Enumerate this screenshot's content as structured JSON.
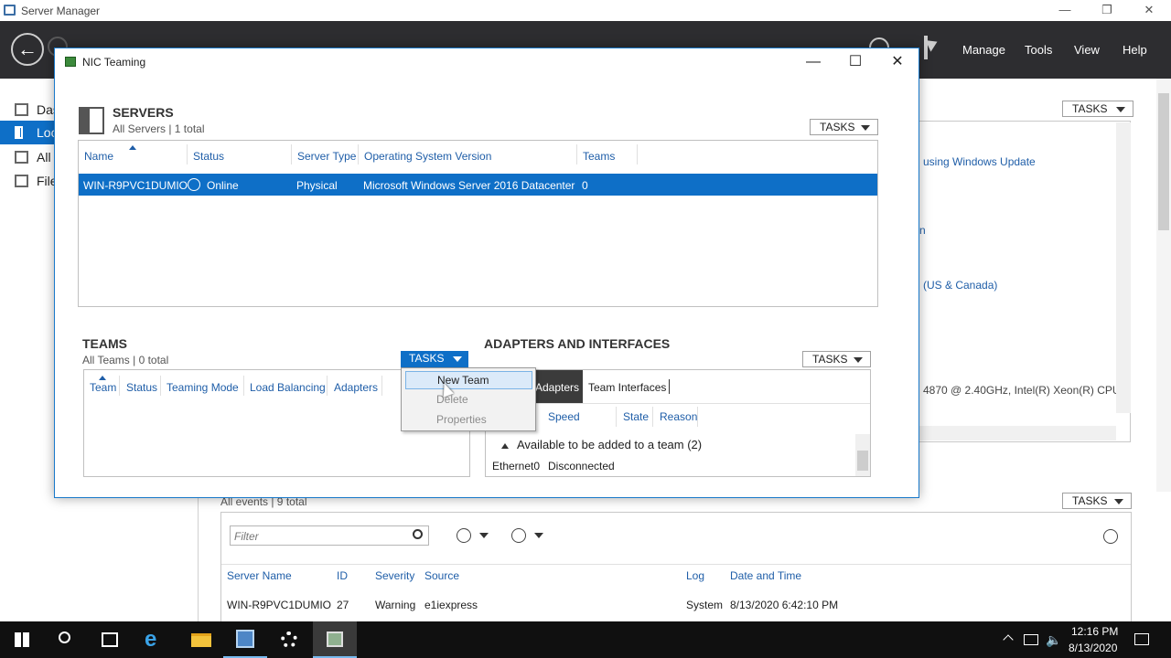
{
  "server_manager": {
    "title": "Server Manager",
    "header_menu": [
      "Manage",
      "Tools",
      "View",
      "Help"
    ],
    "sidebar_items": [
      "Das",
      "Loc",
      "All",
      "File"
    ],
    "right_panel": {
      "tasks_label": "TASKS",
      "link_1": "using Windows Update",
      "link_2": "n",
      "link_3": "(US & Canada)",
      "cpu_text": "4870  @ 2.40GHz, Intel(R) Xeon(R) CPU"
    },
    "events": {
      "subtitle": "All events | 9 total",
      "tasks_label": "TASKS",
      "filter_placeholder": "Filter",
      "columns": [
        "Server Name",
        "ID",
        "Severity",
        "Source",
        "Log",
        "Date and Time"
      ],
      "row": [
        "WIN-R9PVC1DUMIO",
        "27",
        "Warning",
        "e1iexpress",
        "System",
        "8/13/2020 6:42:10 PM"
      ]
    }
  },
  "nic_teaming": {
    "title": "NIC Teaming",
    "servers": {
      "heading": "SERVERS",
      "subtitle": "All Servers | 1 total",
      "tasks_label": "TASKS",
      "columns": [
        "Name",
        "Status",
        "Server Type",
        "Operating System Version",
        "Teams"
      ],
      "row": {
        "name": "WIN-R9PVC1DUMIO",
        "status": "Online",
        "server_type": "Physical",
        "os": "Microsoft Windows Server 2016 Datacenter",
        "teams": "0"
      }
    },
    "teams": {
      "heading": "TEAMS",
      "subtitle": "All Teams | 0 total",
      "tasks_label": "TASKS",
      "columns": [
        "Team",
        "Status",
        "Teaming Mode",
        "Load Balancing",
        "Adapters"
      ]
    },
    "context_menu": {
      "items": [
        "New Team",
        "Delete",
        "Properties"
      ]
    },
    "adapters": {
      "heading": "ADAPTERS AND INTERFACES",
      "tasks_label": "TASKS",
      "tabs": [
        "Adapters",
        "Team Interfaces"
      ],
      "columns": [
        "Speed",
        "State",
        "Reason"
      ],
      "group_label": "Available to be added to a team (2)",
      "row": [
        "Ethernet0",
        "Disconnected"
      ]
    }
  },
  "taskbar": {
    "time": "12:16 PM",
    "date": "8/13/2020"
  }
}
